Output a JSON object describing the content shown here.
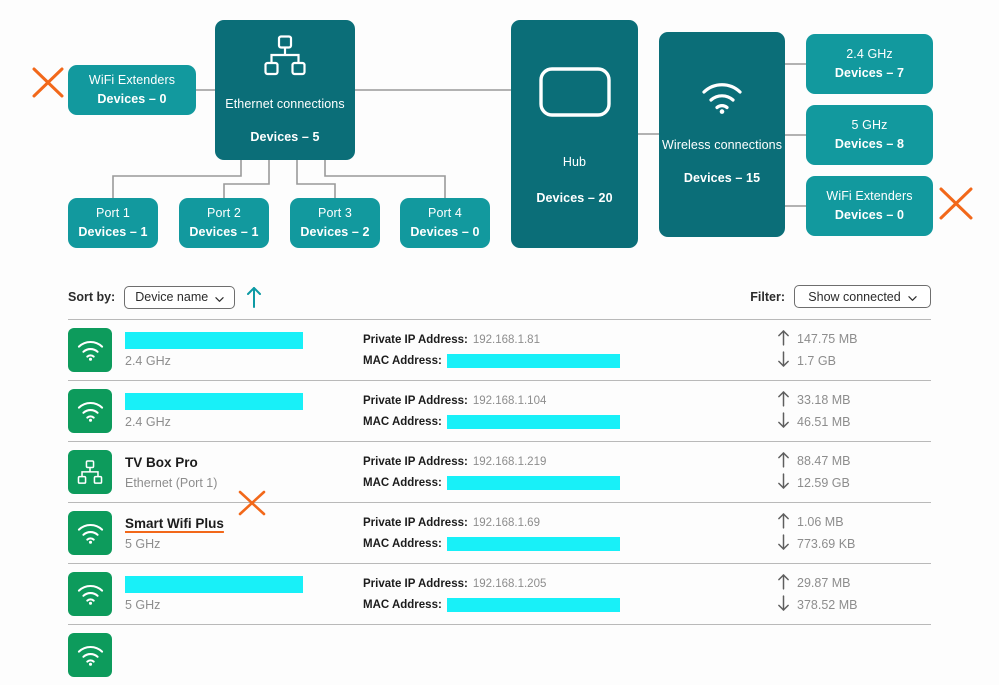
{
  "topology": {
    "nodes": [
      {
        "id": "wifi-ext-left",
        "title": "WiFi Extenders",
        "devices": "Devices – 0",
        "tone": "light"
      },
      {
        "id": "ethernet",
        "title": "Ethernet connections",
        "devices": "Devices – 5",
        "tone": "dark",
        "icon": "network-tree-icon"
      },
      {
        "id": "hub",
        "title": "Hub",
        "devices": "Devices – 20",
        "tone": "dark",
        "icon": "router-icon"
      },
      {
        "id": "wireless",
        "title": "Wireless connections",
        "devices": "Devices – 15",
        "tone": "dark",
        "icon": "wifi-icon"
      },
      {
        "id": "24ghz",
        "title": "2.4 GHz",
        "devices": "Devices – 7",
        "tone": "light"
      },
      {
        "id": "5ghz",
        "title": "5 GHz",
        "devices": "Devices – 8",
        "tone": "light"
      },
      {
        "id": "wifi-ext-right",
        "title": "WiFi Extenders",
        "devices": "Devices – 0",
        "tone": "light"
      },
      {
        "id": "port1",
        "title": "Port 1",
        "devices": "Devices – 1",
        "tone": "light"
      },
      {
        "id": "port2",
        "title": "Port 2",
        "devices": "Devices – 1",
        "tone": "light"
      },
      {
        "id": "port3",
        "title": "Port 3",
        "devices": "Devices – 2",
        "tone": "light"
      },
      {
        "id": "port4",
        "title": "Port 4",
        "devices": "Devices – 0",
        "tone": "light"
      }
    ],
    "annotations": [
      {
        "id": "xmark-left",
        "kind": "x-mark",
        "color": "#f2681a"
      },
      {
        "id": "xmark-right",
        "kind": "x-mark",
        "color": "#f2681a"
      },
      {
        "id": "xmark-row",
        "kind": "x-mark",
        "color": "#f2681a"
      }
    ],
    "colors": {
      "node_light": "#12999e",
      "node_dark": "#0b6e78",
      "link": "#9a9a9a",
      "annotation": "#f2681a"
    }
  },
  "controls": {
    "sort_label": "Sort by:",
    "sort_value": "Device name",
    "sort_direction_icon": "arrow-up-icon",
    "sort_direction_color": "#0d9aa4",
    "filter_label": "Filter:",
    "filter_value": "Show connected"
  },
  "list": {
    "labels": {
      "ip": "Private IP Address:",
      "mac": "MAC Address:"
    },
    "icon_color": "#0d9b5c",
    "redaction_color": "#18f0f8",
    "rows": [
      {
        "icon": "wifi-icon",
        "name": null,
        "name_redacted": true,
        "connection": "2.4 GHz",
        "ip": "192.168.1.81",
        "mac": null,
        "mac_redacted": true,
        "upload": "147.75 MB",
        "download": "1.7 GB",
        "annotated": false
      },
      {
        "icon": "wifi-icon",
        "name": null,
        "name_redacted": true,
        "connection": "2.4 GHz",
        "ip": "192.168.1.104",
        "mac": null,
        "mac_redacted": true,
        "upload": "33.18 MB",
        "download": "46.51 MB",
        "annotated": false
      },
      {
        "icon": "network-tree-icon",
        "name": "TV Box Pro",
        "name_redacted": false,
        "connection": "Ethernet (Port 1)",
        "ip": "192.168.1.219",
        "mac": null,
        "mac_redacted": true,
        "upload": "88.47 MB",
        "download": "12.59 GB",
        "annotated": false
      },
      {
        "icon": "wifi-icon",
        "name": "Smart Wifi Plus",
        "name_redacted": false,
        "connection": "5 GHz",
        "ip": "192.168.1.69",
        "mac": null,
        "mac_redacted": true,
        "upload": "1.06 MB",
        "download": "773.69 KB",
        "annotated": true
      },
      {
        "icon": "wifi-icon",
        "name": null,
        "name_redacted": true,
        "connection": "5 GHz",
        "ip": "192.168.1.205",
        "mac": null,
        "mac_redacted": true,
        "upload": "29.87 MB",
        "download": "378.52 MB",
        "annotated": false
      }
    ]
  }
}
